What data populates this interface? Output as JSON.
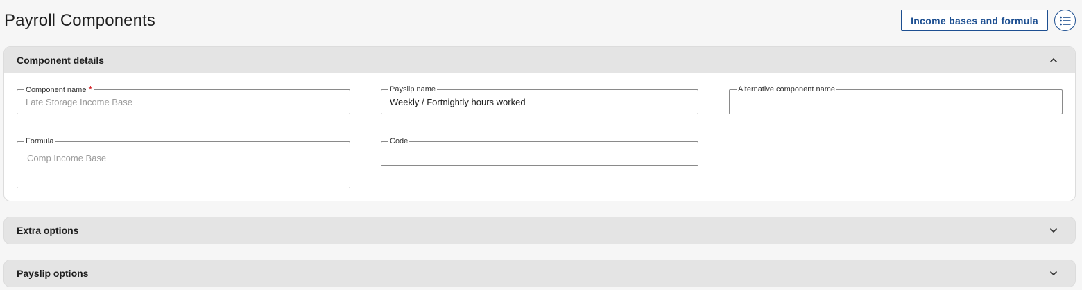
{
  "page": {
    "title": "Payroll Components",
    "income_button_label": "Income bases and formula",
    "list_icon": "list-icon"
  },
  "colors": {
    "accent": "#1d4f91",
    "required": "#d6262b",
    "panel_header": "#e4e4e4",
    "background": "#f6f6f6"
  },
  "sections": {
    "component_details": {
      "title": "Component details",
      "expanded": true,
      "fields": {
        "component_name": {
          "label": "Component name",
          "required": true,
          "value": "",
          "placeholder": "Late Storage Income Base"
        },
        "payslip_name": {
          "label": "Payslip name",
          "value": "Weekly / Fortnightly hours worked"
        },
        "alternative_component_name": {
          "label": "Alternative component name",
          "value": ""
        },
        "formula": {
          "label": "Formula",
          "value": "",
          "placeholder": "Comp Income Base"
        },
        "code": {
          "label": "Code",
          "value": ""
        }
      }
    },
    "extra_options": {
      "title": "Extra options",
      "expanded": false
    },
    "payslip_options": {
      "title": "Payslip options",
      "expanded": false
    }
  }
}
